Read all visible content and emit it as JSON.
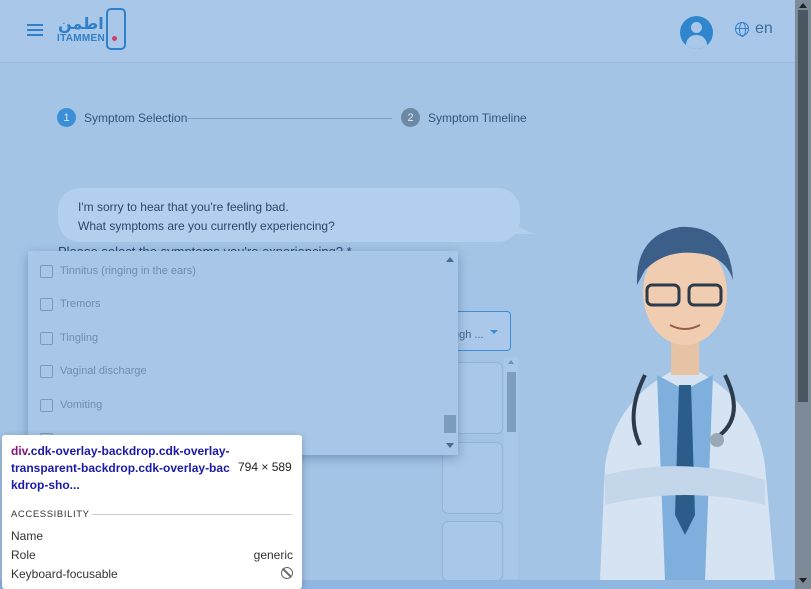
{
  "header": {
    "logo_arabic": "اطمن",
    "logo_english": "ITAMMEN",
    "language": "en"
  },
  "stepper": {
    "steps": [
      {
        "number": "1",
        "label": "Symptom Selection"
      },
      {
        "number": "2",
        "label": "Symptom Timeline"
      }
    ]
  },
  "chat": {
    "line1": "I'm sorry to hear that you're feeling bad.",
    "line2": "What symptoms are you currently experiencing?",
    "prompt": "Please select the symptoms you're experiencing? *"
  },
  "select": {
    "value": "ugh ..."
  },
  "dropdown": {
    "options": [
      "Tinnitus (ringing in the ears)",
      "Tremors",
      "Tingling",
      "Vaginal discharge",
      "Vomiting"
    ]
  },
  "devtools_tooltip": {
    "selector_tag": "div",
    "selector_classes": ".cdk-overlay-backdrop.cdk-overlay-transparent-backdrop.cdk-overlay-backdrop-sho...",
    "dimensions": "794 × 589",
    "section": "ACCESSIBILITY",
    "rows": {
      "name_label": "Name",
      "name_value": "",
      "role_label": "Role",
      "role_value": "generic",
      "focusable_label": "Keyboard-focusable"
    }
  },
  "colors": {
    "accent": "#3b8fd8",
    "backdrop": "#a4c4e6"
  }
}
